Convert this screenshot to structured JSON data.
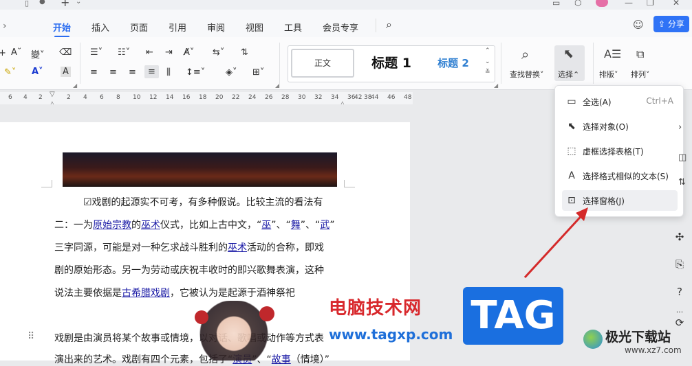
{
  "tabs": [
    {
      "label": "开始",
      "active": true
    },
    {
      "label": "插入"
    },
    {
      "label": "页面"
    },
    {
      "label": "引用"
    },
    {
      "label": "审阅"
    },
    {
      "label": "视图"
    },
    {
      "label": "工具"
    },
    {
      "label": "会员专享"
    }
  ],
  "share_label": "分享",
  "ribbon": {
    "styles": {
      "normal": "正文",
      "heading1": "标题 1",
      "heading2": "标题 2"
    },
    "find_replace": "查找替换",
    "select": "选择",
    "layout": "排版",
    "arrange": "排列"
  },
  "ruler_labels": [
    "6",
    "4",
    "2",
    "2",
    "4",
    "6",
    "8",
    "10",
    "12",
    "14",
    "16",
    "18",
    "20",
    "22",
    "24",
    "26",
    "28",
    "30",
    "32",
    "34",
    "36",
    "38",
    "42",
    "44",
    "46",
    "48"
  ],
  "document": {
    "lines": [
      {
        "segments": [
          {
            "t": "☑戏剧的起源实不可考，有多种假说。比较主流的看法有"
          }
        ],
        "indent": true
      },
      {
        "segments": [
          {
            "t": "二：一为"
          },
          {
            "t": "原始宗教",
            "link": true
          },
          {
            "t": "的"
          },
          {
            "t": "巫术",
            "link": true
          },
          {
            "t": "仪式，比如上古中文，“"
          },
          {
            "t": "巫",
            "link": true
          },
          {
            "t": "”、“"
          },
          {
            "t": "舞",
            "link": true
          },
          {
            "t": "”、“"
          },
          {
            "t": "武",
            "link": true
          },
          {
            "t": "”"
          }
        ]
      },
      {
        "segments": [
          {
            "t": "三字同源，可能是对一种乞求战斗胜利的"
          },
          {
            "t": "巫术",
            "link": true
          },
          {
            "t": "活动的合称，即戏"
          }
        ]
      },
      {
        "segments": [
          {
            "t": "剧的原始形态。另一为劳动或庆祝丰收时的即兴歌舞表演，这种"
          }
        ]
      },
      {
        "segments": [
          {
            "t": "说法主要依据是"
          },
          {
            "t": "古希腊戏剧",
            "link": true
          },
          {
            "t": "，它被认为是起源于酒神祭祀"
          }
        ]
      },
      {
        "segments": [
          {
            "t": "戏剧是由演员将某个故事或情境，以对话、歌唱或动作等方式表"
          }
        ]
      },
      {
        "segments": [
          {
            "t": "演出来的艺术。戏剧有四个元素，包括了“"
          },
          {
            "t": "演员",
            "link": true
          },
          {
            "t": "”、“"
          },
          {
            "t": "故事",
            "link": true
          },
          {
            "t": "（情境）”"
          }
        ]
      }
    ]
  },
  "select_menu": {
    "items": [
      {
        "label": "全选(A)",
        "shortcut": "Ctrl+A",
        "icon": "select-all-icon"
      },
      {
        "label": "选择对象(O)",
        "icon": "cursor-arrow-icon"
      },
      {
        "label": "虚框选择表格(T)",
        "icon": "table-select-icon"
      },
      {
        "label": "选择格式相似的文本(S)",
        "icon": "text-format-icon"
      },
      {
        "label": "选择窗格(J)",
        "icon": "selection-pane-icon",
        "highlighted": true
      }
    ]
  },
  "watermark": {
    "site_name": "电脑技术网",
    "url": "www.tagxp.com",
    "tag": "TAG",
    "logo_text": "极光下载站",
    "logo_url": "www.xz7.com"
  },
  "colors": {
    "accent": "#2b6df0",
    "link": "#1a1aa6",
    "annotation_arrow": "#d42a2a",
    "watermark_red": "#d8282c",
    "watermark_blue": "#1a6fe0"
  }
}
